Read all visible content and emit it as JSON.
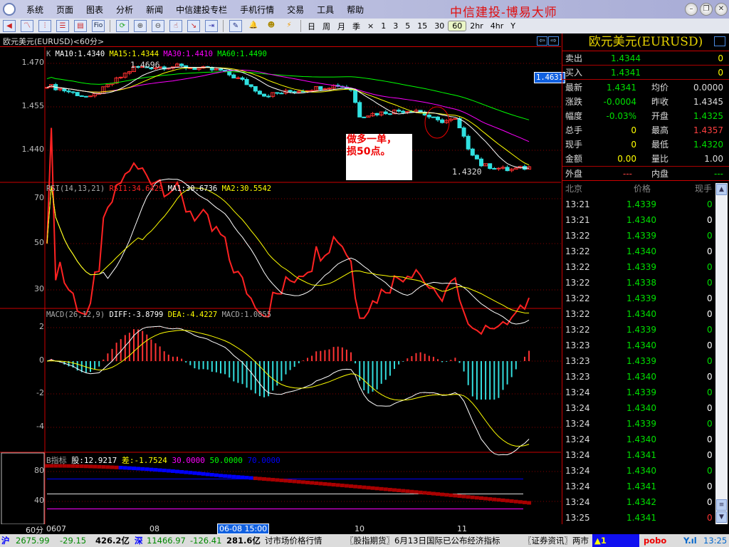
{
  "menu": [
    "系统",
    "页面",
    "图表",
    "分析",
    "新闻",
    "中信建投专栏",
    "手机行情",
    "交易",
    "工具",
    "帮助"
  ],
  "app_title": "中信建投-博易大师",
  "toolbar": {
    "fio_label": "Fio",
    "periods": [
      "日",
      "周",
      "月",
      "季",
      "×",
      "1",
      "3",
      "5",
      "15",
      "30",
      "60",
      "2hr",
      "4hr",
      "Y"
    ],
    "active_period": "60"
  },
  "chart": {
    "title": "欧元美元(EURUSD)<60分>",
    "kline": {
      "label": "K",
      "ma10": "MA10:1.4340",
      "ma15": "MA15:1.4344",
      "ma30": "MA30:1.4410",
      "ma60": "MA60:1.4490",
      "y_ticks": [
        "1.470",
        "1.455",
        "1.440"
      ],
      "high_label": "1.4696",
      "low_label": "1.4320",
      "price_badge": "1.4631",
      "annotation_line1": "做多一单，",
      "annotation_line2": "损50点。"
    },
    "rsi": {
      "label": "RSI(14,13,21)",
      "rsi1": "RSI1:34.6429",
      "ma1": "MA1:30.6736",
      "ma2": "MA2:30.5542",
      "y_ticks": [
        "70",
        "50",
        "30"
      ]
    },
    "macd": {
      "label": "MACD(26,12,9)",
      "diff": "DIFF:-3.8799",
      "dea": "DEA:-4.4227",
      "macd": "MACD:1.0855",
      "y_ticks": [
        "2",
        "0",
        "-2",
        "-4"
      ]
    },
    "b": {
      "label": "B指标",
      "gu": "股:12.9217",
      "cha": "差:-1.7524",
      "l30": "30.0000",
      "l50": "50.0000",
      "l70": "70.0000",
      "y_ticks": [
        "80",
        "40"
      ]
    },
    "x_axis": {
      "period": "60分",
      "labels": [
        "0607",
        "08",
        "10",
        "11"
      ],
      "cursor": "06-08 15:00"
    },
    "price_path": [
      [
        0,
        1.4625
      ],
      [
        10,
        1.458
      ],
      [
        20,
        1.4685
      ],
      [
        30,
        1.469
      ],
      [
        40,
        1.4675
      ],
      [
        45,
        1.464
      ],
      [
        50,
        1.459
      ],
      [
        57,
        1.4605
      ],
      [
        67,
        1.4625
      ],
      [
        70,
        1.461
      ],
      [
        72,
        1.452
      ],
      [
        80,
        1.4535
      ],
      [
        85,
        1.454
      ],
      [
        90,
        1.45
      ],
      [
        94,
        1.4505
      ],
      [
        97,
        1.441
      ],
      [
        100,
        1.435
      ],
      [
        106,
        1.4332
      ],
      [
        111,
        1.4341
      ]
    ],
    "colors": {
      "up": "#ff3030",
      "down": "#30e0e0",
      "ma10": "#ffffff",
      "ma15": "#ffff00",
      "ma30": "#ff00ff",
      "ma60": "#00ff00"
    }
  },
  "quote": {
    "title": "欧元美元(EURUSD)",
    "sell": {
      "label": "卖出",
      "price": "1.4344",
      "vol": "0"
    },
    "buy": {
      "label": "买入",
      "price": "1.4341",
      "vol": "0"
    },
    "rows": [
      [
        {
          "l": "最新",
          "v": "1.4341",
          "c": "#00e000"
        },
        {
          "l": "均价",
          "v": "0.0000",
          "c": "#ddd"
        }
      ],
      [
        {
          "l": "涨跌",
          "v": "-0.0004",
          "c": "#00e000"
        },
        {
          "l": "昨收",
          "v": "1.4345",
          "c": "#ddd"
        }
      ],
      [
        {
          "l": "幅度",
          "v": "-0.03%",
          "c": "#00e000"
        },
        {
          "l": "开盘",
          "v": "1.4325",
          "c": "#00e000"
        }
      ],
      [
        {
          "l": "总手",
          "v": "0",
          "c": "#ffff00"
        },
        {
          "l": "最高",
          "v": "1.4357",
          "c": "#ff4040"
        }
      ],
      [
        {
          "l": "现手",
          "v": "0",
          "c": "#ffff00"
        },
        {
          "l": "最低",
          "v": "1.4320",
          "c": "#00e000"
        }
      ],
      [
        {
          "l": "金额",
          "v": "0.00",
          "c": "#ffff00"
        },
        {
          "l": "量比",
          "v": "1.00",
          "c": "#ddd"
        }
      ]
    ],
    "outer": {
      "label": "外盘",
      "value": "---"
    },
    "inner": {
      "label": "内盘",
      "value": "---"
    },
    "tick_headers": [
      "北京",
      "价格",
      "现手"
    ],
    "ticks": [
      [
        "13:21",
        "1.4339",
        "0",
        "g"
      ],
      [
        "13:21",
        "1.4340",
        "0",
        "w"
      ],
      [
        "13:22",
        "1.4339",
        "0",
        "g"
      ],
      [
        "13:22",
        "1.4340",
        "0",
        "w"
      ],
      [
        "13:22",
        "1.4339",
        "0",
        "g"
      ],
      [
        "13:22",
        "1.4338",
        "0",
        "g"
      ],
      [
        "13:22",
        "1.4339",
        "0",
        "w"
      ],
      [
        "13:22",
        "1.4340",
        "0",
        "w"
      ],
      [
        "13:22",
        "1.4339",
        "0",
        "g"
      ],
      [
        "13:23",
        "1.4340",
        "0",
        "w"
      ],
      [
        "13:23",
        "1.4339",
        "0",
        "g"
      ],
      [
        "13:23",
        "1.4340",
        "0",
        "w"
      ],
      [
        "13:24",
        "1.4339",
        "0",
        "g"
      ],
      [
        "13:24",
        "1.4340",
        "0",
        "w"
      ],
      [
        "13:24",
        "1.4339",
        "0",
        "g"
      ],
      [
        "13:24",
        "1.4340",
        "0",
        "w"
      ],
      [
        "13:24",
        "1.4341",
        "0",
        "w"
      ],
      [
        "13:24",
        "1.4340",
        "0",
        "g"
      ],
      [
        "13:24",
        "1.4341",
        "0",
        "w"
      ],
      [
        "13:24",
        "1.4342",
        "0",
        "w"
      ],
      [
        "13:25",
        "1.4341",
        "0",
        "r"
      ]
    ]
  },
  "status": {
    "sh_label": "沪",
    "sh_index": "2675.99",
    "sh_change": "-29.15",
    "sh_amount": "426.2亿",
    "sz_label": "深",
    "sz_index": "11466.97",
    "sz_change": "-126.41",
    "sz_amount": "281.6亿",
    "ticker1": "讨市场价格行情",
    "ticker2": "〖股指期货〗6月13日国际已公布经济指标",
    "ticker3": "〖证券资讯〗两市",
    "alert": "▲1",
    "brand": "pobo",
    "signal": "Y.ıl",
    "time": "13:25"
  }
}
